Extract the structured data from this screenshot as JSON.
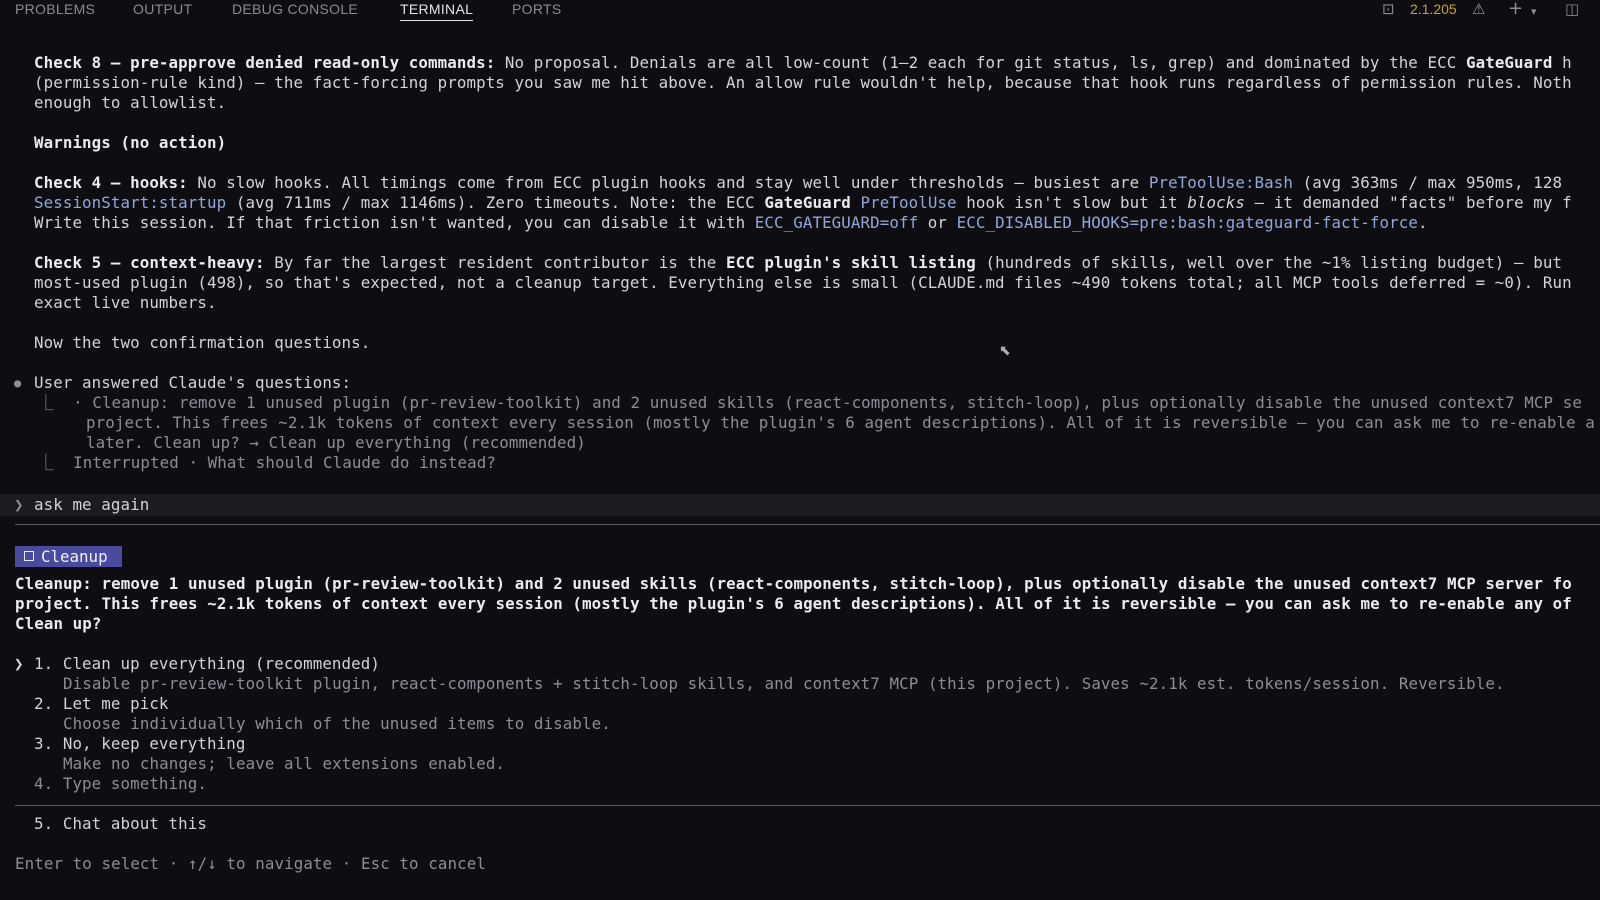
{
  "panel_tabs": [
    "PROBLEMS",
    "OUTPUT",
    "DEBUG CONSOLE",
    "TERMINAL",
    "PORTS"
  ],
  "toolbar": {
    "version": "2.1.205",
    "terminal_icon": "terminal-icon",
    "warning_icon": "warning-icon",
    "add_icon": "plus-icon",
    "dropdown_icon": "chevron-down-icon",
    "split_icon": "split-panel-icon"
  },
  "check8": {
    "label": "Check 8 — pre-approve denied read-only commands:",
    "text1": " No proposal. Denials are all low-count (1–2 each for git status, ls, grep) and dominated by the ECC ",
    "gateguard": "GateGuard",
    "text1_tail": " h",
    "line2": "(permission-rule kind) — the fact-forcing prompts you saw me hit above. An allow rule wouldn't help, because that hook runs regardless of permission rules. Noth",
    "line3": "enough to allowlist."
  },
  "warnings_heading": "Warnings (no action)",
  "check4": {
    "label": "Check 4 — hooks:",
    "text1": " No slow hooks. All timings come from ECC plugin hooks and stay well under thresholds — busiest are ",
    "hook1": "PreToolUse:Bash",
    "text1_tail": " (avg 363ms / max 950ms, 128",
    "hook2": "SessionStart:startup",
    "text2a": " (avg 711ms / max 1146ms). Zero timeouts. Note: the ECC ",
    "gateguard": "GateGuard",
    "text2b": " ",
    "hook3": "PreToolUse",
    "text2c": " hook isn't slow but it ",
    "blocks": "blocks",
    "text2d": " — it demanded \"facts\" before my f",
    "text3a": "Write this session. If that friction isn't wanted, you can disable it with ",
    "env1": "ECC_GATEGUARD=off",
    "text3b": " or ",
    "env2": "ECC_DISABLED_HOOKS=pre:bash:gateguard-fact-force",
    "text3c": "."
  },
  "check5": {
    "label": "Check 5 — context-heavy:",
    "text1": " By far the largest resident contributor is the ",
    "bold": "ECC plugin's skill listing",
    "text1_tail": " (hundreds of skills, well over the ~1% listing budget) — but",
    "line2": "most-used plugin (498), so that's expected, not a cleanup target. Everything else is small (CLAUDE.md files ~490 tokens total; all MCP tools deferred = ~0). Run",
    "line3": "exact live numbers."
  },
  "now_line": "Now the two confirmation questions.",
  "answered": {
    "bullet": "●",
    "title": "User answered Claude's questions:",
    "a1": "⎿  · Cleanup: remove 1 unused plugin (pr-review-toolkit) and 2 unused skills (react-components, stitch-loop), plus optionally disable the unused context7 MCP se",
    "a2": "     project. This frees ~2.1k tokens of context every session (mostly the plugin's 6 agent descriptions). All of it is reversible — you can ask me to re-enable a",
    "a3": "     later. Clean up? → Clean up everything (recommended)",
    "a4": "⎿  Interrupted · What should Claude do instead?"
  },
  "prompt": {
    "marker": "❯",
    "text": "ask me again"
  },
  "chip": {
    "label": "Cleanup",
    "icon": "checkbox-icon"
  },
  "question": {
    "l1": "Cleanup: remove 1 unused plugin (pr-review-toolkit) and 2 unused skills (react-components, stitch-loop), plus optionally disable the unused context7 MCP server fo",
    "l2": "project. This frees ~2.1k tokens of context every session (mostly the plugin's 6 agent descriptions). All of it is reversible — you can ask me to re-enable any of",
    "l3": "Clean up?"
  },
  "options": [
    {
      "marker": "❯",
      "label": "1. Clean up everything (recommended)",
      "desc": "Disable pr-review-toolkit plugin, react-components + stitch-loop skills, and context7 MCP (this project). Saves ~2.1k est. tokens/session. Reversible."
    },
    {
      "marker": "",
      "label": "2. Let me pick",
      "desc": "Choose individually which of the unused items to disable."
    },
    {
      "marker": "",
      "label": "3. No, keep everything",
      "desc": "Make no changes; leave all extensions enabled."
    },
    {
      "marker": "",
      "label": "4. Type something.",
      "desc": ""
    }
  ],
  "chat_option": "5. Chat about this",
  "footer": "Enter to select · ↑/↓ to navigate · Esc to cancel"
}
